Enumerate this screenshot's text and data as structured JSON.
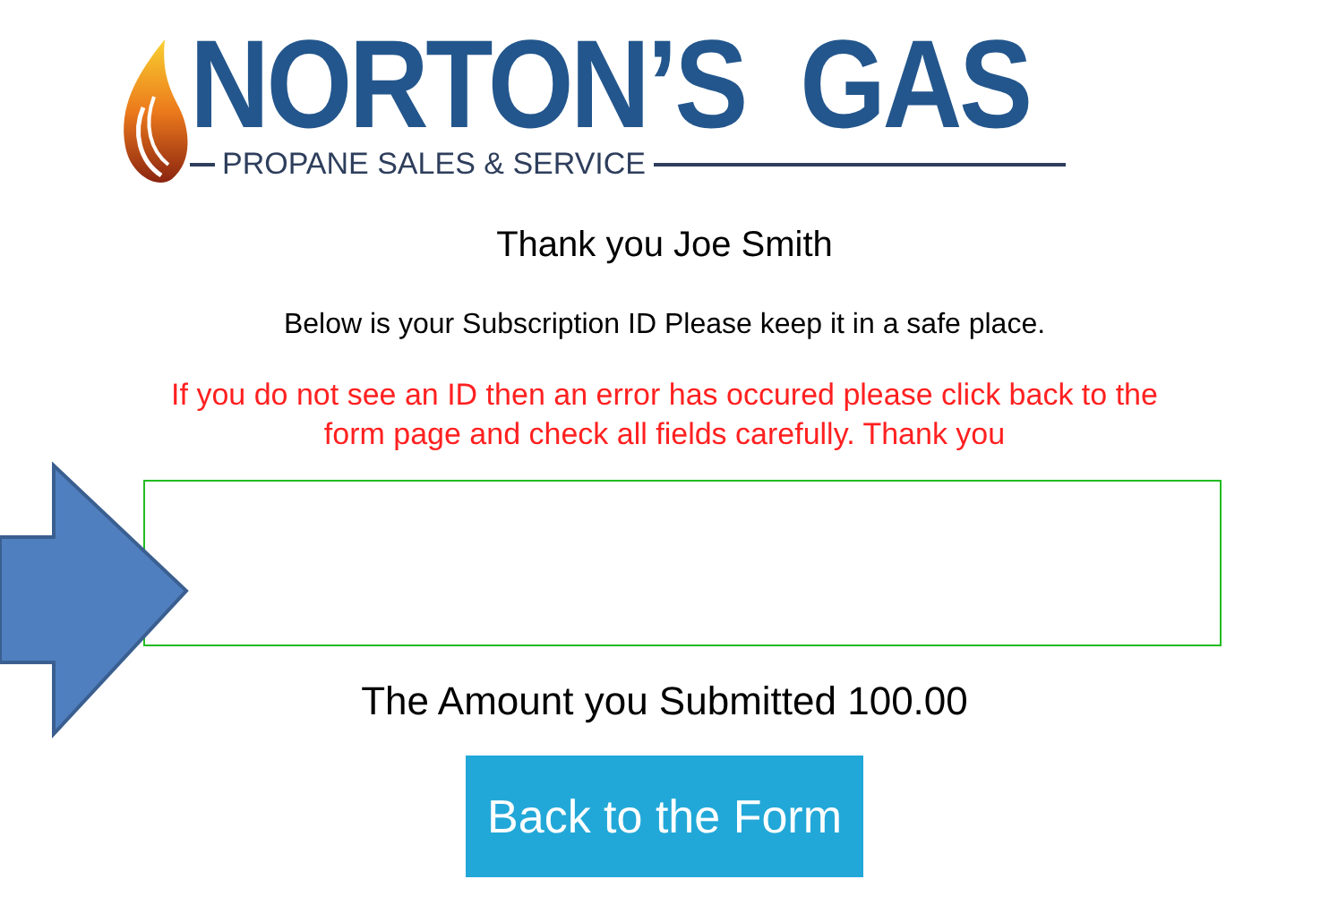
{
  "logo": {
    "title": "NORTON’S  GAS",
    "tagline": "PROPANE SALES & SERVICE"
  },
  "greeting": "Thank you Joe Smith",
  "instruction": "Below is your Subscription ID Please keep it in a safe place.",
  "error_notice": "If you do not see an ID then an error has occured please click back to the form page and check all fields carefully. Thank you",
  "amount": "The Amount you Submitted 100.00",
  "button": "Back to the Form"
}
